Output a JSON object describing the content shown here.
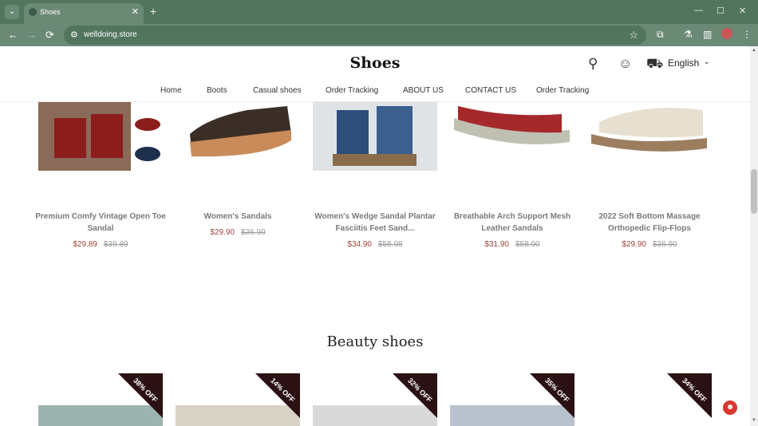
{
  "browser": {
    "tab_title": "Shoes",
    "tab_close": "✕",
    "new_tab": "+",
    "url": "welldoing.store",
    "back": "←",
    "forward": "→",
    "reload": "⟳",
    "min": "—",
    "max": "☐",
    "close": "✕",
    "menu": "⋮"
  },
  "header": {
    "logo": "Shoes",
    "language": "English",
    "nav": [
      "Home",
      "Boots",
      "Casual shoes",
      "Order Tracking",
      "ABOUT US",
      "CONTACT US",
      "Order Tracking"
    ]
  },
  "products": [
    {
      "name": "Premium Comfy Vintage Open Toe Sandal",
      "price": "$29.89",
      "was": "$39.89"
    },
    {
      "name": "Women's Sandals",
      "price": "$29.90",
      "was": "$36.90"
    },
    {
      "name": "Women's Wedge Sandal Plantar Fasciitis Feet Sand...",
      "price": "$34.90",
      "was": "$55.98"
    },
    {
      "name": "Breathable Arch Support Mesh Leather Sandals",
      "price": "$31.90",
      "was": "$58.90"
    },
    {
      "name": "2022 Soft Bottom Massage Orthopedic Flip-Flops",
      "price": "$29.90",
      "was": "$36.90"
    }
  ],
  "section": {
    "title": "Beauty shoes"
  },
  "badges": [
    "38% OFF",
    "14% OFF",
    "32% OFF",
    "35% OFF",
    "34% OFF"
  ],
  "colors": {
    "accent": "#a0453b",
    "ribbon": "#2b1014",
    "chrome": "#52755e"
  }
}
